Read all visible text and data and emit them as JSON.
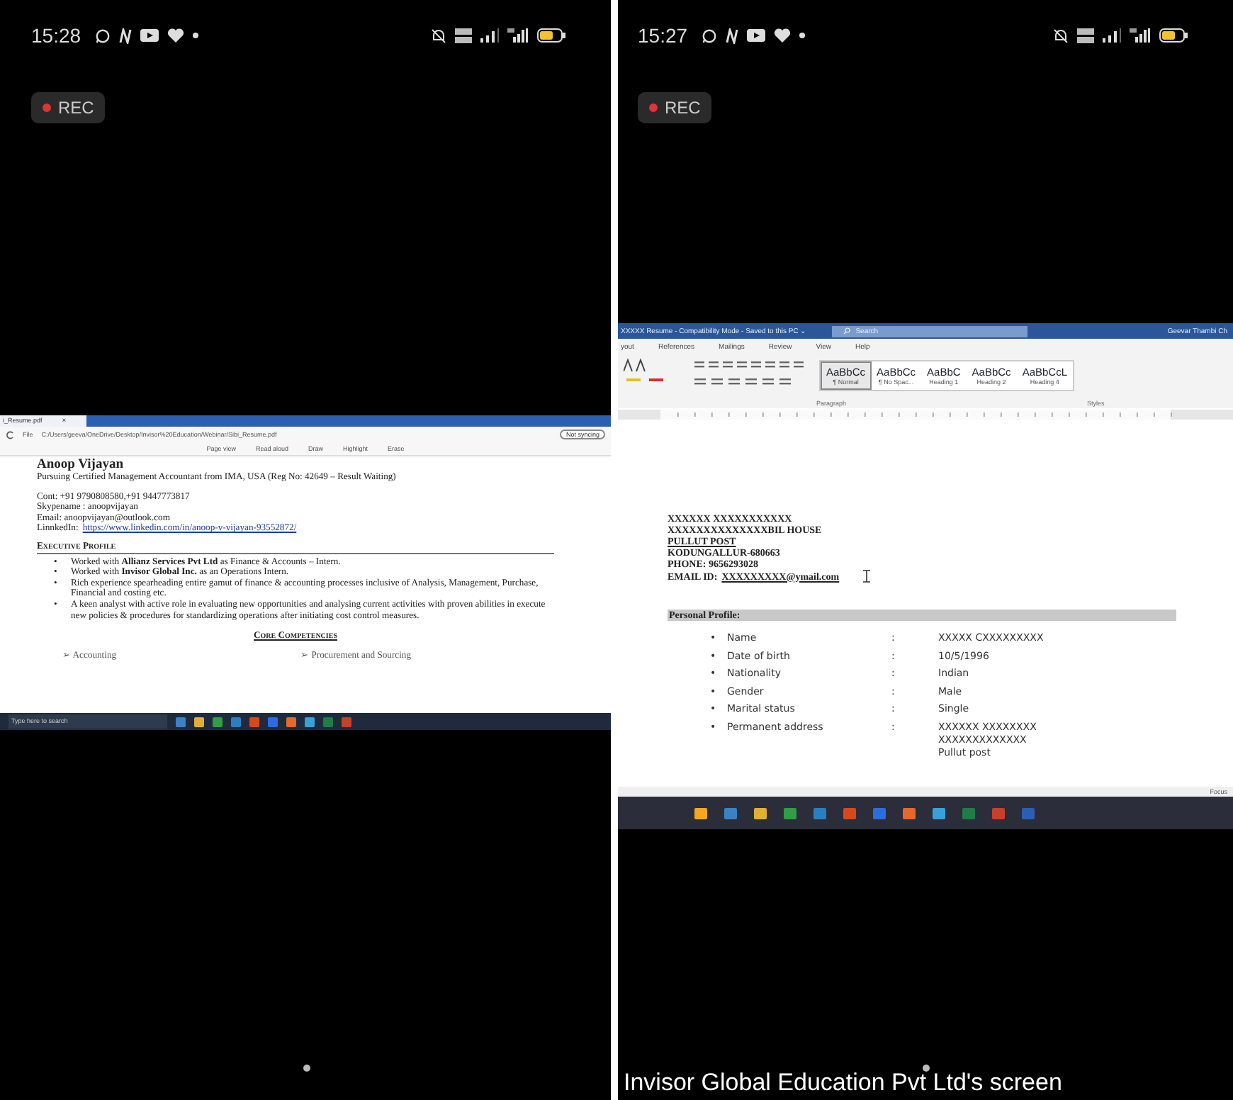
{
  "screens": [
    {
      "kind": "pdf_viewer",
      "status_bar": {
        "time": "15:28"
      },
      "rec_label": "REC",
      "pdf_viewer": {
        "tab_title": "i_Resume.pdf",
        "tab_close": "×",
        "address_label": "File",
        "address": "C:/Users/geeva/OneDrive/Desktop/Invisor%20Education/Webinar/Sibi_Resume.pdf",
        "sync_button": "Not syncing",
        "toolbar": [
          "Page view",
          "Read aloud",
          "Draw",
          "Highlight",
          "Erase"
        ],
        "document": {
          "name": "Anoop Vijayan",
          "subtitle": "Pursuing Certified Management Accountant from IMA, USA (Reg No: 42649 – Result Waiting)",
          "contact_lines": [
            "Cont: +91 9790808580,+91 9447773817",
            "Skypename : anoopvijayan",
            "Email: anoopvijayan@outlook.com"
          ],
          "linkedin_label": "LinnkedIn:",
          "linkedin_url": "https://www.linkedin.com/in/anoop-v-vijayan-93552872/",
          "section_heading": "Executive Profile",
          "bullet_marker": "•",
          "arrow_marker": "➢",
          "bullets": [
            "Worked with **Allianz Services Pvt Ltd** as Finance & Accounts – Intern.",
            "Worked with **Invisor Global Inc.** as an Operations Intern.",
            "Rich experience spearheading entire gamut of finance & accounting processes inclusive of Analysis, Management, Purchase, Financial and costing etc.",
            "A keen analyst with active role in evaluating new opportunities and analysing current activities with proven abilities in execute new policies & procedures for standardizing operations after initiating cost control measures."
          ],
          "competencies_heading": "Core Competencies",
          "competencies": [
            "Accounting",
            "Procurement and Sourcing"
          ]
        },
        "taskbar_search": "Type here to search"
      }
    },
    {
      "kind": "word_document",
      "status_bar": {
        "time": "15:27"
      },
      "rec_label": "REC",
      "word": {
        "title": "XXXXX Resume  -  Compatibility Mode  -  Saved to this PC  ⌄",
        "search_placeholder": "Search",
        "user": "Geevar Thambi Ch",
        "ribbon_tabs": [
          "yout",
          "References",
          "Mailings",
          "Review",
          "View",
          "Help"
        ],
        "styles": [
          {
            "sample": "AaBbCc",
            "name": "¶ Normal",
            "selected": true
          },
          {
            "sample": "AaBbCc",
            "name": "¶ No Spac...",
            "selected": false
          },
          {
            "sample": "AaBbC",
            "name": "Heading 1",
            "selected": false
          },
          {
            "sample": "AaBbCc",
            "name": "Heading 2",
            "selected": false
          },
          {
            "sample": "AaBbCcL",
            "name": "Heading 4",
            "selected": false
          }
        ],
        "group_labels": [
          "Paragraph",
          "Styles"
        ],
        "address_lines": [
          "XXXXXX XXXXXXXXXXX",
          "XXXXXXXXXXXXXXBIL HOUSE",
          "PULLUT  POST",
          "KODUNGALLUR-680663",
          "PHONE: 9656293028"
        ],
        "email_label": "EMAIL ID:",
        "email": "XXXXXXXXX@ymail.com",
        "profile_heading": "Personal Profile:",
        "bullet_marker": "•",
        "separator": ":",
        "profile": [
          {
            "label": "Name",
            "value_lines": [
              "XXXXX CXXXXXXXXX"
            ]
          },
          {
            "label": "Date of birth",
            "value_lines": [
              "10/5/1996"
            ]
          },
          {
            "label": "Nationality",
            "value_lines": [
              "Indian"
            ]
          },
          {
            "label": "Gender",
            "value_lines": [
              "Male"
            ]
          },
          {
            "label": "Marital status",
            "value_lines": [
              "Single"
            ]
          },
          {
            "label": "Permanent address",
            "value_lines": [
              "XXXXXX XXXXXXXX",
              "XXXXXXXXXXXXX",
              "Pullut post"
            ]
          }
        ],
        "focus_label": "Focus"
      },
      "caption": "Invisor Global Education Pvt Ltd's screen"
    }
  ]
}
